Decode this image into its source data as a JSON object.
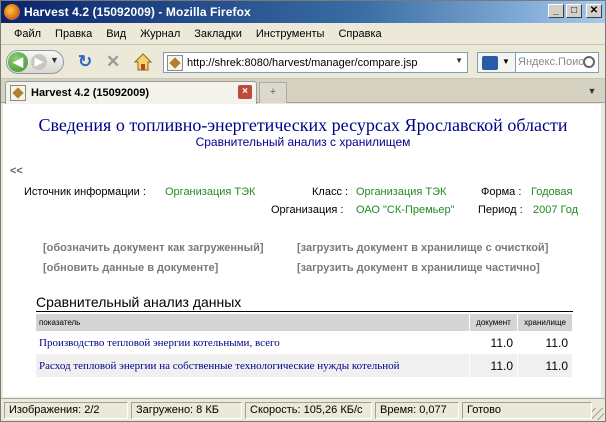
{
  "window": {
    "title": "Harvest 4.2 (15092009) - Mozilla Firefox",
    "buttons": {
      "minimize": "_",
      "maximize": "□",
      "close": "✕"
    }
  },
  "menubar": {
    "items": [
      {
        "label": "Файл"
      },
      {
        "label": "Правка"
      },
      {
        "label": "Вид"
      },
      {
        "label": "Журнал"
      },
      {
        "label": "Закладки"
      },
      {
        "label": "Инструменты"
      },
      {
        "label": "Справка"
      }
    ]
  },
  "navbar": {
    "url": "http://shrek:8080/harvest/manager/compare.jsp",
    "search_placeholder": "Яндекс.Поиск",
    "icons": {
      "back": "back-arrow-icon",
      "forward": "forward-arrow-icon",
      "reload": "reload-icon",
      "stop": "stop-icon",
      "home": "home-icon"
    }
  },
  "tabs": {
    "active": {
      "label": "Harvest 4.2 (15092009)"
    },
    "new_tab_symbol": "+"
  },
  "page": {
    "title": "Сведения о топливно-энергетических ресурсах Ярославской области",
    "subtitle": "Сравнительный анализ с хранилищем",
    "back_link": "<<",
    "info": {
      "source_label": "Источник информации :",
      "source_value": "Организация ТЭК",
      "class_label": "Класс :",
      "class_value": "Организация ТЭК",
      "form_label": "Форма :",
      "form_value": "Годовая",
      "org_label": "Организация :",
      "org_value": "ОАО \"СК-Премьер\"",
      "period_label": "Период :",
      "period_value": "2007 Год"
    },
    "actions": {
      "mark_loaded": "[обозначить документ как загруженный]",
      "update_data": "[обновить данные в документе]",
      "load_with_clean": "[загрузить документ в хранилище с очисткой]",
      "load_partial": "[загрузить документ в хранилище частично]"
    },
    "section_title": "Сравнительный анализ данных",
    "table": {
      "headers": {
        "indicator": "показатель",
        "document": "документ",
        "storage": "хранилище"
      },
      "rows": [
        {
          "indicator": "Производство тепловой энергии котельными, всего",
          "document": "11.0",
          "storage": "11.0"
        },
        {
          "indicator": "Расход тепловой энергии на собственные технологические нужды котельной",
          "document": "11.0",
          "storage": "11.0"
        }
      ]
    }
  },
  "statusbar": {
    "images": "Изображения: 2/2",
    "loaded": "Загружено: 8 КБ",
    "speed": "Скорость: 105,26 КБ/с",
    "time": "Время: 0,077",
    "state": "Готово"
  },
  "colors": {
    "title_blue": "#00008b",
    "value_green": "#228b22",
    "action_gray": "#7a7a7a",
    "table_header": "#d4d4d4"
  }
}
